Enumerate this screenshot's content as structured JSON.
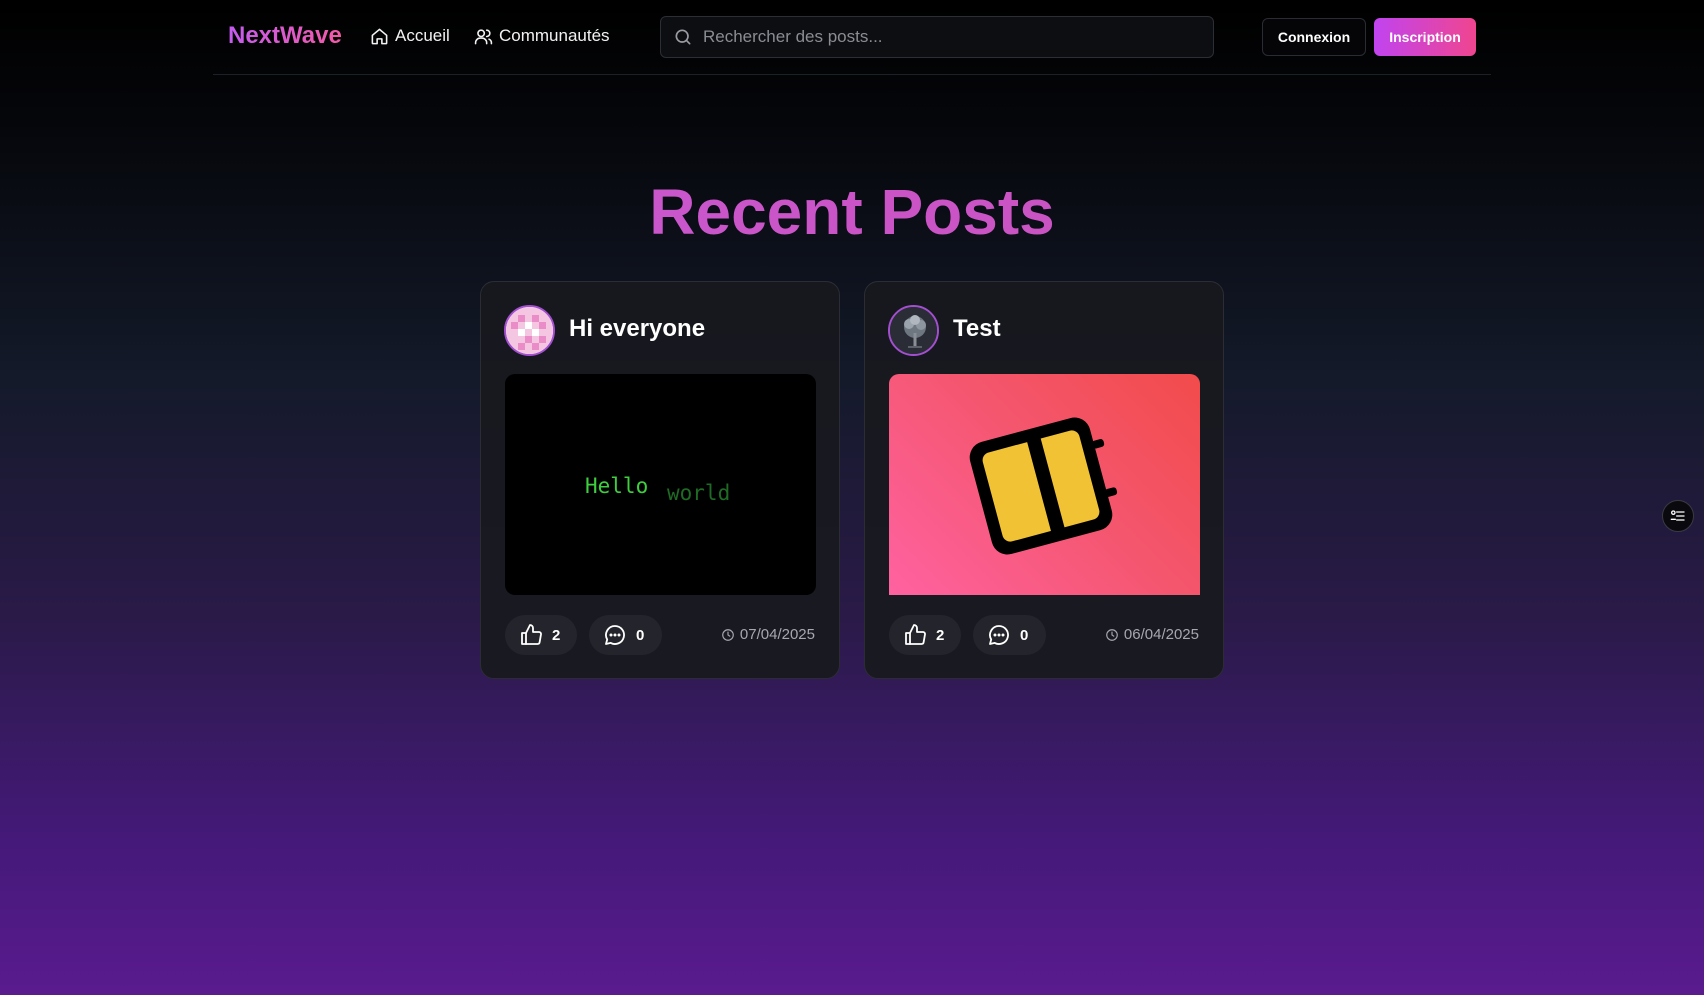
{
  "brand": {
    "name": "NextWave"
  },
  "nav": {
    "home_label": "Accueil",
    "communities_label": "Communautés"
  },
  "search": {
    "placeholder": "Rechercher des posts..."
  },
  "auth": {
    "login_label": "Connexion",
    "signup_label": "Inscription"
  },
  "main": {
    "title": "Recent Posts"
  },
  "posts": [
    {
      "title": "Hi everyone",
      "image_text": [
        "Hello",
        "world"
      ],
      "likes": "2",
      "comments": "0",
      "date": "07/04/2025",
      "avatar_icon": "checker-avatar",
      "image_icon": "code-preview"
    },
    {
      "title": "Test",
      "likes": "2",
      "comments": "0",
      "date": "06/04/2025",
      "avatar_icon": "tree-avatar",
      "image_icon": "notebook-icon"
    }
  ],
  "colors": {
    "accent_start": "#c044f0",
    "accent_end": "#f0458f",
    "title": "#c65ad6",
    "card_bg": "#18191e"
  }
}
